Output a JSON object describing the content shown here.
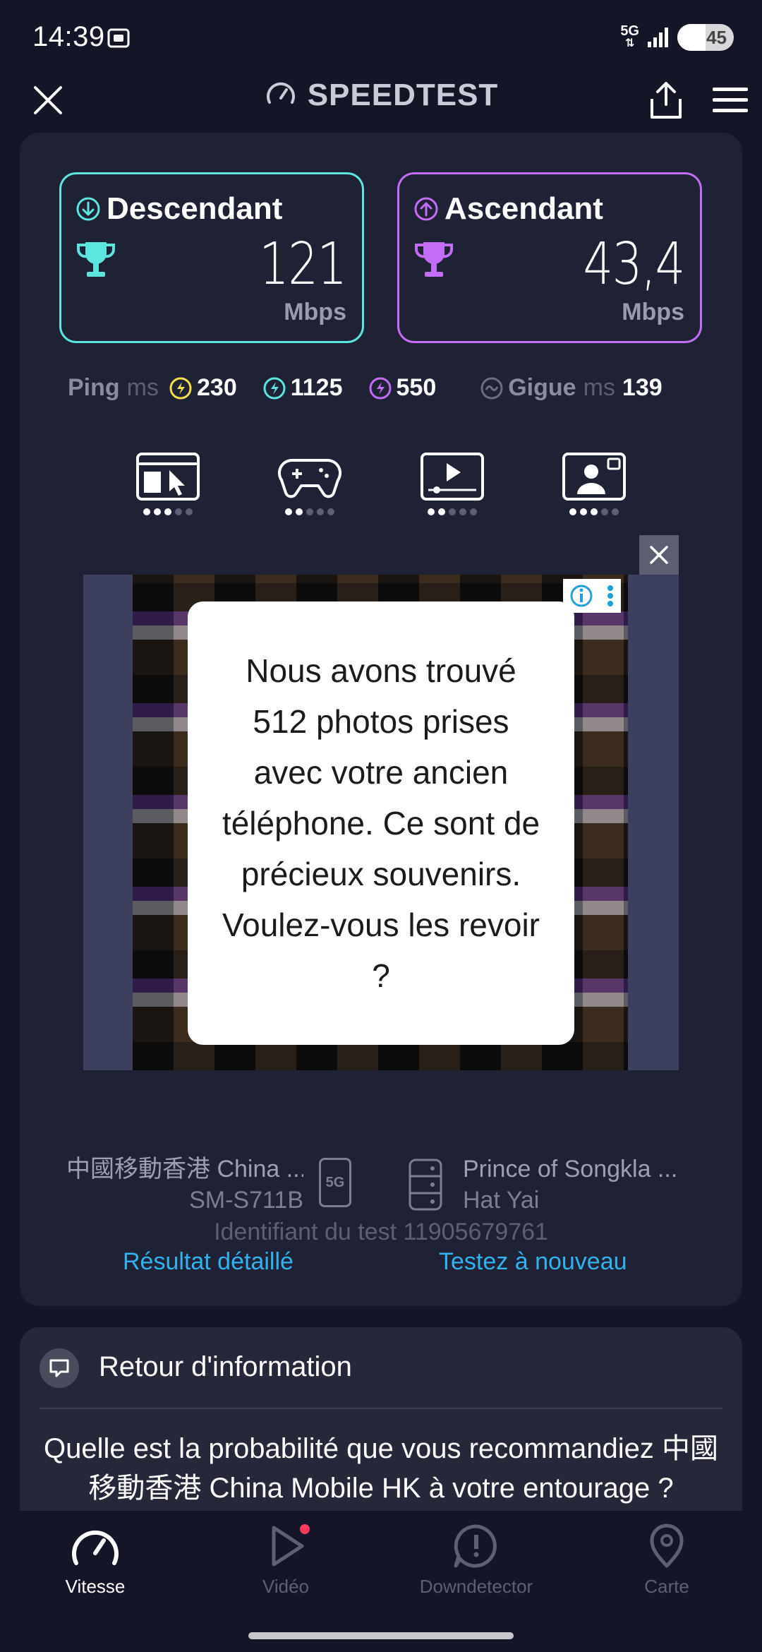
{
  "status_bar": {
    "time": "14:39",
    "network": "5G",
    "battery": "45"
  },
  "header": {
    "title": "SPEEDTEST"
  },
  "download": {
    "label": "Descendant",
    "value": "121",
    "unit": "Mbps"
  },
  "upload": {
    "label": "Ascendant",
    "value": "43,4",
    "unit": "Mbps"
  },
  "ping": {
    "label": "Ping",
    "unit": "ms",
    "idle": "230",
    "download": "1125",
    "upload": "550"
  },
  "jitter": {
    "label": "Gigue",
    "unit": "ms",
    "value": "139"
  },
  "app_ratings": [
    {
      "name": "browsing",
      "level": 3,
      "max": 5
    },
    {
      "name": "gaming",
      "level": 2,
      "max": 5
    },
    {
      "name": "video",
      "level": 2,
      "max": 5
    },
    {
      "name": "video-call",
      "level": 3,
      "max": 5
    }
  ],
  "ad": {
    "text": "Nous avons trouvé 512 photos prises avec votre ancien téléphone. Ce sont de précieux souvenirs. Voulez-vous les revoir ?"
  },
  "provider": {
    "name": "中國移動香港 China ...",
    "device": "SM-S711B",
    "badge": "5G"
  },
  "server": {
    "name": "Prince of Songkla ...",
    "location": "Hat Yai"
  },
  "test_id": "Identifiant du test 11905679761",
  "links": {
    "detail": "Résultat détaillé",
    "again": "Testez à nouveau"
  },
  "feedback": {
    "title": "Retour d'information",
    "question": "Quelle est la probabilité que vous recommandiez 中國移動香港 China Mobile HK à votre entourage ?"
  },
  "nav": {
    "speed": "Vitesse",
    "video": "Vidéo",
    "downdetector": "Downdetector",
    "map": "Carte"
  },
  "colors": {
    "download": "#5de6df",
    "upload": "#c36cf5",
    "idle_ping": "#f4e04d",
    "link": "#32b3ef",
    "notification": "#ff3b5c"
  }
}
